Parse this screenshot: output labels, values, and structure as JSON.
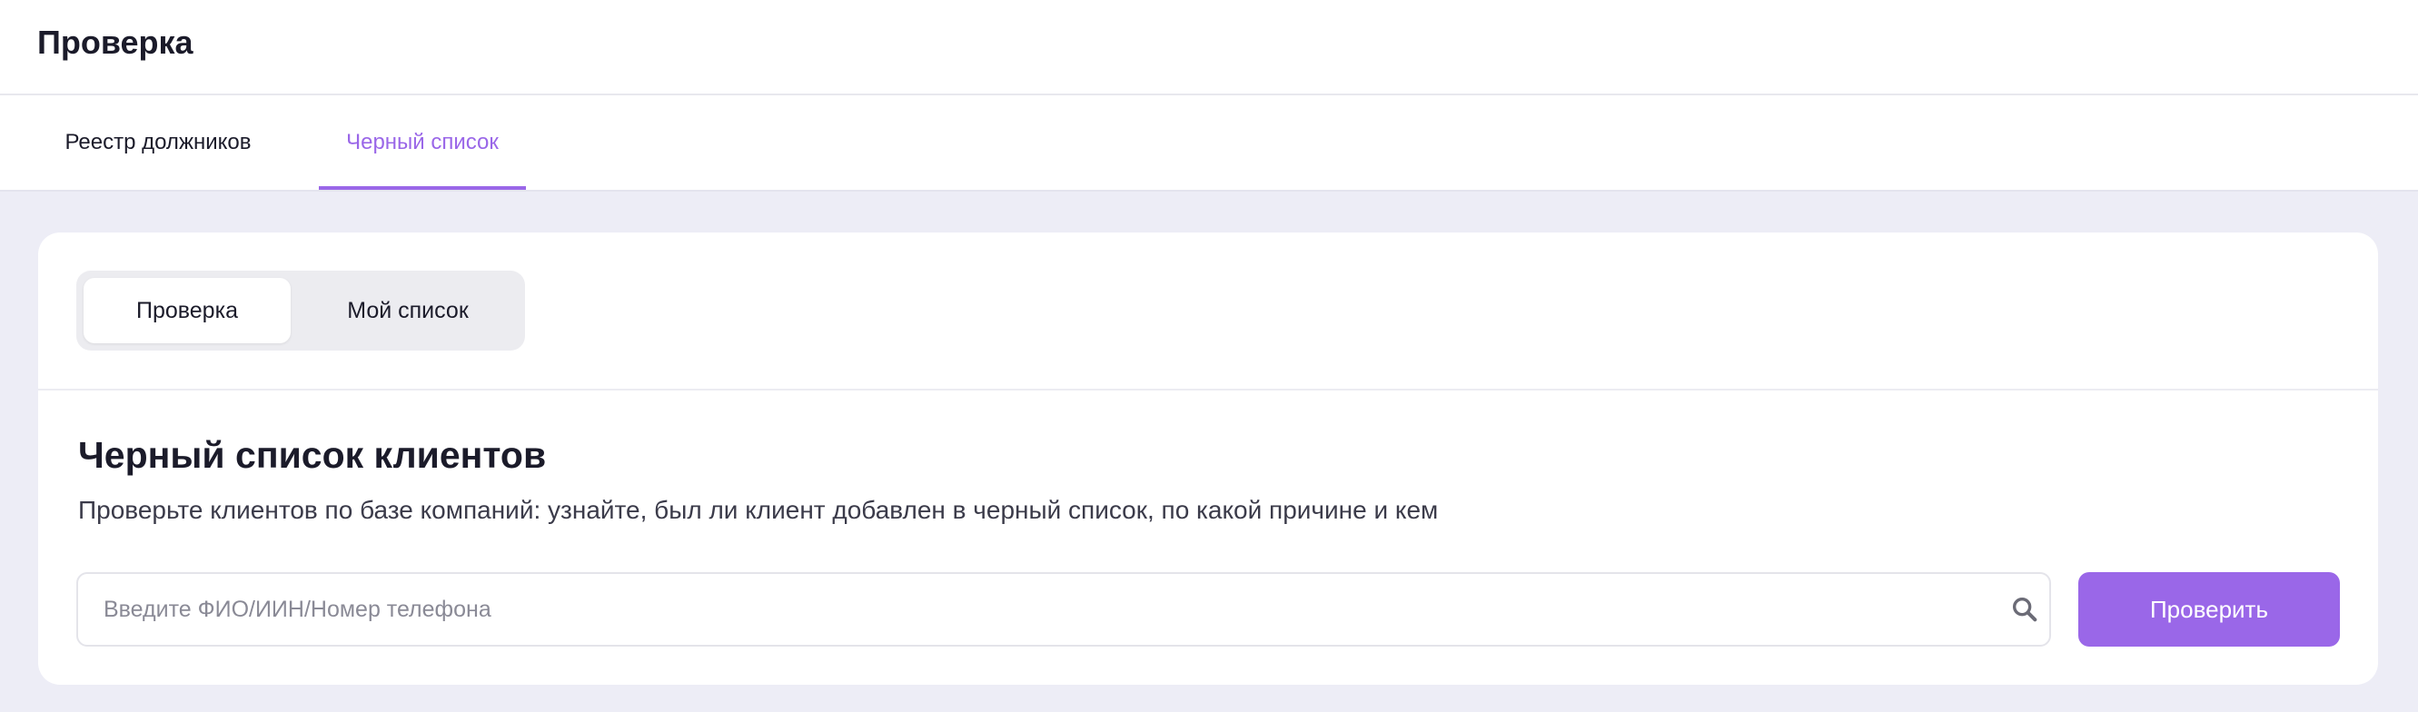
{
  "header": {
    "title": "Проверка"
  },
  "tabs": [
    {
      "label": "Реестр должников",
      "active": false
    },
    {
      "label": "Черный список",
      "active": true
    }
  ],
  "segmented": {
    "options": [
      {
        "label": "Проверка",
        "selected": true
      },
      {
        "label": "Мой список",
        "selected": false
      }
    ]
  },
  "section": {
    "title": "Черный список клиентов",
    "description": "Проверьте клиентов по базе компаний: узнайте, был ли клиент добавлен в черный список, по какой причине и кем"
  },
  "search": {
    "placeholder": "Введите ФИО/ИИН/Номер телефона",
    "value": "",
    "icon": "search-icon"
  },
  "check_button": {
    "label": "Проверить"
  },
  "colors": {
    "accent": "#9a67e8",
    "page_background": "#ededf6",
    "card_background": "#ffffff"
  }
}
